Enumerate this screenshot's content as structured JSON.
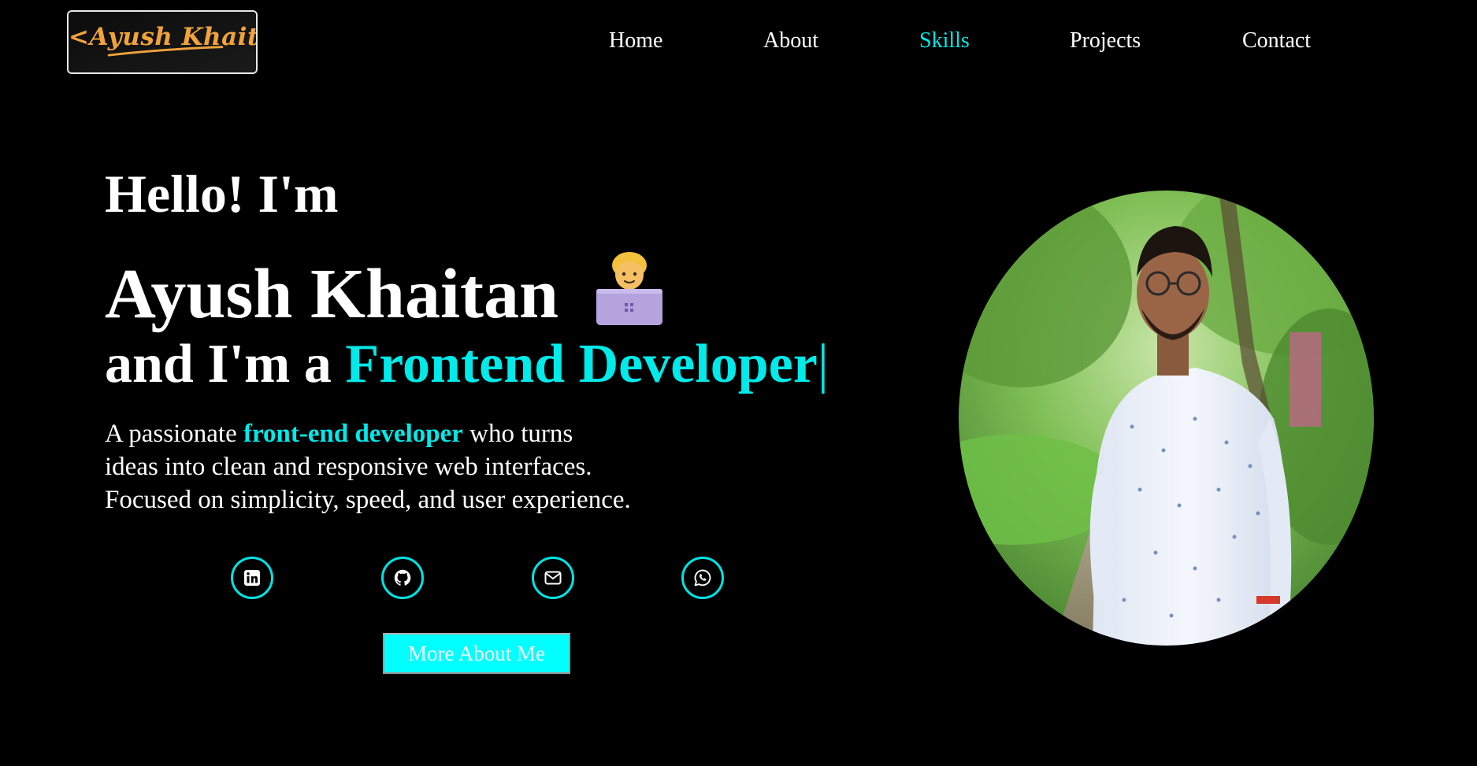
{
  "logo": {
    "text": "<Ayush Khaitan>",
    "color": "#f0a33b"
  },
  "nav": {
    "items": [
      {
        "label": "Home",
        "active": false
      },
      {
        "label": "About",
        "active": false
      },
      {
        "label": "Skills",
        "active": true
      },
      {
        "label": "Projects",
        "active": false
      },
      {
        "label": "Contact",
        "active": false
      }
    ]
  },
  "hero": {
    "greeting": "Hello! I'm",
    "name": "Ayush Khaitan",
    "emoji": "technologist-emoji",
    "role_prefix": "and I'm a ",
    "role": "Frontend Developer",
    "caret": "|",
    "desc_part1": "A passionate ",
    "desc_highlight": "front-end developer",
    "desc_part2": " who turns",
    "desc_line2": "ideas into clean and responsive web interfaces.",
    "desc_line3": "Focused on simplicity, speed, and user experience."
  },
  "social": [
    {
      "icon": "linkedin-icon"
    },
    {
      "icon": "github-icon"
    },
    {
      "icon": "email-icon"
    },
    {
      "icon": "whatsapp-icon"
    }
  ],
  "cta": {
    "label": "More About Me"
  },
  "colors": {
    "accent": "#00eaea",
    "background": "#000000",
    "text": "#ffffff",
    "button": "#00ffff"
  }
}
